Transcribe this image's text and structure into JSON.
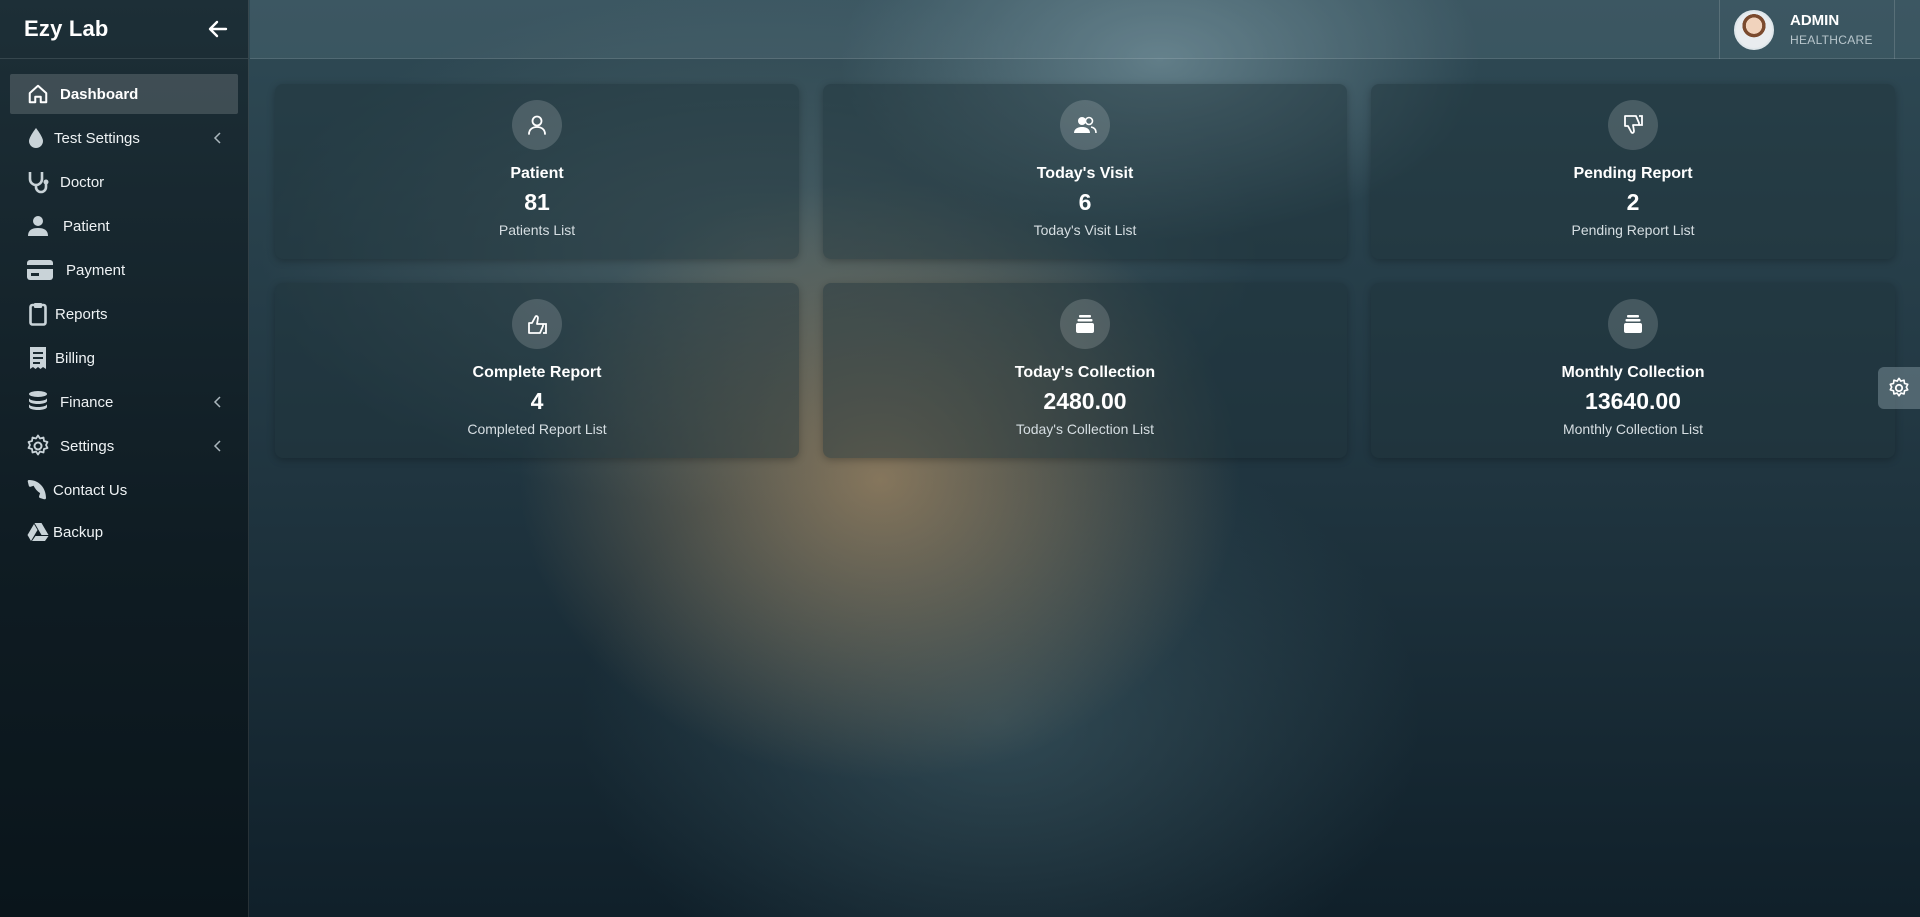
{
  "app": {
    "title": "Ezy Lab"
  },
  "user": {
    "name": "ADMIN",
    "role": "HEALTHCARE"
  },
  "sidebar": {
    "items": [
      {
        "label": "Dashboard",
        "icon": "home-icon",
        "active": true,
        "has_submenu": false
      },
      {
        "label": "Test Settings",
        "icon": "drop-icon",
        "active": false,
        "has_submenu": true
      },
      {
        "label": "Doctor",
        "icon": "stethoscope-icon",
        "active": false,
        "has_submenu": false
      },
      {
        "label": "Patient",
        "icon": "user-icon",
        "active": false,
        "has_submenu": false
      },
      {
        "label": "Payment",
        "icon": "credit-card-icon",
        "active": false,
        "has_submenu": false
      },
      {
        "label": "Reports",
        "icon": "clipboard-icon",
        "active": false,
        "has_submenu": false
      },
      {
        "label": "Billing",
        "icon": "receipt-icon",
        "active": false,
        "has_submenu": false
      },
      {
        "label": "Finance",
        "icon": "coins-icon",
        "active": false,
        "has_submenu": true
      },
      {
        "label": "Settings",
        "icon": "gear-icon",
        "active": false,
        "has_submenu": true
      },
      {
        "label": "Contact Us",
        "icon": "phone-icon",
        "active": false,
        "has_submenu": false
      },
      {
        "label": "Backup",
        "icon": "google-drive-icon",
        "active": false,
        "has_submenu": false
      }
    ]
  },
  "cards": [
    {
      "title": "Patient",
      "value": "81",
      "link": "Patients List",
      "icon": "user-outline-icon"
    },
    {
      "title": "Today's Visit",
      "value": "6",
      "link": "Today's Visit List",
      "icon": "users-icon"
    },
    {
      "title": "Pending Report",
      "value": "2",
      "link": "Pending Report List",
      "icon": "thumbs-down-icon"
    },
    {
      "title": "Complete Report",
      "value": "4",
      "link": "Completed Report List",
      "icon": "thumbs-up-icon"
    },
    {
      "title": "Today's Collection",
      "value": "2480.00",
      "link": "Today's Collection List",
      "icon": "archive-icon"
    },
    {
      "title": "Monthly Collection",
      "value": "13640.00",
      "link": "Monthly Collection List",
      "icon": "archive-icon"
    }
  ]
}
